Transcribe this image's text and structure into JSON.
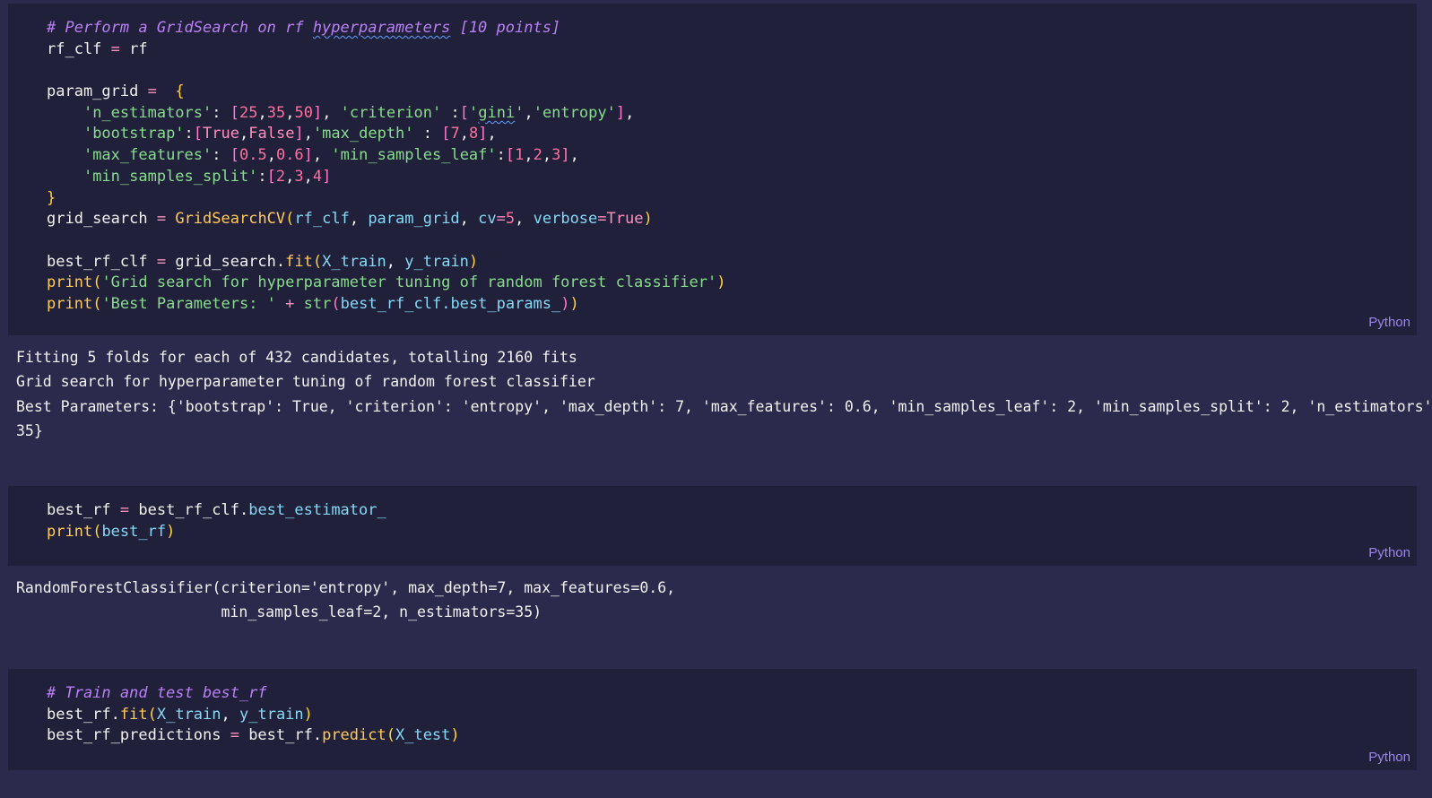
{
  "cell1": {
    "language": "Python",
    "lines": [
      [
        {
          "t": "# Perform a GridSearch on rf ",
          "c": "com"
        },
        {
          "t": "hyperparameters",
          "c": "com",
          "squig": true
        },
        {
          "t": " [10 points]",
          "c": "com"
        }
      ],
      [
        {
          "t": "rf_clf ",
          "c": ""
        },
        {
          "t": "=",
          "c": "op"
        },
        {
          "t": " rf",
          "c": ""
        }
      ],
      [],
      [
        {
          "t": "param_grid ",
          "c": ""
        },
        {
          "t": "=",
          "c": "op"
        },
        {
          "t": "  ",
          "c": ""
        },
        {
          "t": "{",
          "c": "brk"
        }
      ],
      [
        {
          "t": "    ",
          "c": ""
        },
        {
          "t": "'n_estimators'",
          "c": "str"
        },
        {
          "t": ": ",
          "c": ""
        },
        {
          "t": "[",
          "c": "brk2"
        },
        {
          "t": "25",
          "c": "num"
        },
        {
          "t": ",",
          "c": ""
        },
        {
          "t": "35",
          "c": "num"
        },
        {
          "t": ",",
          "c": ""
        },
        {
          "t": "50",
          "c": "num"
        },
        {
          "t": "]",
          "c": "brk2"
        },
        {
          "t": ", ",
          "c": ""
        },
        {
          "t": "'criterion'",
          "c": "str"
        },
        {
          "t": " :",
          "c": ""
        },
        {
          "t": "[",
          "c": "brk2"
        },
        {
          "t": "'",
          "c": "str"
        },
        {
          "t": "gini",
          "c": "str",
          "squig": true
        },
        {
          "t": "'",
          "c": "str"
        },
        {
          "t": ",",
          "c": ""
        },
        {
          "t": "'entropy'",
          "c": "str"
        },
        {
          "t": "]",
          "c": "brk2"
        },
        {
          "t": ",",
          "c": ""
        }
      ],
      [
        {
          "t": "    ",
          "c": ""
        },
        {
          "t": "'bootstrap'",
          "c": "str"
        },
        {
          "t": ":",
          "c": ""
        },
        {
          "t": "[",
          "c": "brk2"
        },
        {
          "t": "True",
          "c": "kw"
        },
        {
          "t": ",",
          "c": ""
        },
        {
          "t": "False",
          "c": "kw"
        },
        {
          "t": "]",
          "c": "brk2"
        },
        {
          "t": ",",
          "c": ""
        },
        {
          "t": "'max_depth'",
          "c": "str"
        },
        {
          "t": " : ",
          "c": ""
        },
        {
          "t": "[",
          "c": "brk2"
        },
        {
          "t": "7",
          "c": "num"
        },
        {
          "t": ",",
          "c": ""
        },
        {
          "t": "8",
          "c": "num"
        },
        {
          "t": "]",
          "c": "brk2"
        },
        {
          "t": ",",
          "c": ""
        }
      ],
      [
        {
          "t": "    ",
          "c": ""
        },
        {
          "t": "'max_features'",
          "c": "str"
        },
        {
          "t": ": ",
          "c": ""
        },
        {
          "t": "[",
          "c": "brk2"
        },
        {
          "t": "0.5",
          "c": "num"
        },
        {
          "t": ",",
          "c": ""
        },
        {
          "t": "0.6",
          "c": "num"
        },
        {
          "t": "]",
          "c": "brk2"
        },
        {
          "t": ", ",
          "c": ""
        },
        {
          "t": "'min_samples_leaf'",
          "c": "str"
        },
        {
          "t": ":",
          "c": ""
        },
        {
          "t": "[",
          "c": "brk2"
        },
        {
          "t": "1",
          "c": "num"
        },
        {
          "t": ",",
          "c": ""
        },
        {
          "t": "2",
          "c": "num"
        },
        {
          "t": ",",
          "c": ""
        },
        {
          "t": "3",
          "c": "num"
        },
        {
          "t": "]",
          "c": "brk2"
        },
        {
          "t": ",",
          "c": ""
        }
      ],
      [
        {
          "t": "    ",
          "c": ""
        },
        {
          "t": "'min_samples_split'",
          "c": "str"
        },
        {
          "t": ":",
          "c": ""
        },
        {
          "t": "[",
          "c": "brk2"
        },
        {
          "t": "2",
          "c": "num"
        },
        {
          "t": ",",
          "c": ""
        },
        {
          "t": "3",
          "c": "num"
        },
        {
          "t": ",",
          "c": ""
        },
        {
          "t": "4",
          "c": "num"
        },
        {
          "t": "]",
          "c": "brk2"
        }
      ],
      [
        {
          "t": "}",
          "c": "brk"
        }
      ],
      [
        {
          "t": "grid_search ",
          "c": ""
        },
        {
          "t": "=",
          "c": "op"
        },
        {
          "t": " ",
          "c": ""
        },
        {
          "t": "GridSearchCV",
          "c": "fn"
        },
        {
          "t": "(",
          "c": "brk"
        },
        {
          "t": "rf_clf",
          "c": "var"
        },
        {
          "t": ", ",
          "c": ""
        },
        {
          "t": "param_grid",
          "c": "var"
        },
        {
          "t": ", ",
          "c": ""
        },
        {
          "t": "cv",
          "c": "var"
        },
        {
          "t": "=",
          "c": "op"
        },
        {
          "t": "5",
          "c": "num"
        },
        {
          "t": ", ",
          "c": ""
        },
        {
          "t": "verbose",
          "c": "var"
        },
        {
          "t": "=",
          "c": "op"
        },
        {
          "t": "True",
          "c": "kw"
        },
        {
          "t": ")",
          "c": "brk"
        }
      ],
      [],
      [
        {
          "t": "best_rf_clf ",
          "c": ""
        },
        {
          "t": "=",
          "c": "op"
        },
        {
          "t": " grid_search.",
          "c": ""
        },
        {
          "t": "fit",
          "c": "fn"
        },
        {
          "t": "(",
          "c": "brk"
        },
        {
          "t": "X_train",
          "c": "var"
        },
        {
          "t": ", ",
          "c": ""
        },
        {
          "t": "y_train",
          "c": "var"
        },
        {
          "t": ")",
          "c": "brk"
        }
      ],
      [
        {
          "t": "print",
          "c": "fn"
        },
        {
          "t": "(",
          "c": "brk"
        },
        {
          "t": "'Grid search for hyperparameter tuning of random forest classifier'",
          "c": "str"
        },
        {
          "t": ")",
          "c": "brk"
        }
      ],
      [
        {
          "t": "print",
          "c": "fn"
        },
        {
          "t": "(",
          "c": "brk"
        },
        {
          "t": "'Best Parameters: '",
          "c": "str"
        },
        {
          "t": " ",
          "c": ""
        },
        {
          "t": "+",
          "c": "op"
        },
        {
          "t": " ",
          "c": ""
        },
        {
          "t": "str",
          "c": "str"
        },
        {
          "t": "(",
          "c": "brk2"
        },
        {
          "t": "best_rf_clf.best_params_",
          "c": "var"
        },
        {
          "t": ")",
          "c": "brk2"
        },
        {
          "t": ")",
          "c": "brk"
        }
      ]
    ]
  },
  "output1": {
    "lines": [
      "Fitting 5 folds for each of 432 candidates, totalling 2160 fits",
      "Grid search for hyperparameter tuning of random forest classifier",
      "Best Parameters: {'bootstrap': True, 'criterion': 'entropy', 'max_depth': 7, 'max_features': 0.6, 'min_samples_leaf': 2, 'min_samples_split': 2, 'n_estimators':",
      "35}"
    ]
  },
  "cell2": {
    "language": "Python",
    "lines": [
      [
        {
          "t": "best_rf ",
          "c": ""
        },
        {
          "t": "=",
          "c": "op"
        },
        {
          "t": " best_rf_clf.",
          "c": ""
        },
        {
          "t": "best_estimator_",
          "c": "var"
        }
      ],
      [
        {
          "t": "print",
          "c": "fn"
        },
        {
          "t": "(",
          "c": "brk"
        },
        {
          "t": "best_rf",
          "c": "var"
        },
        {
          "t": ")",
          "c": "brk"
        }
      ]
    ]
  },
  "output2": {
    "lines": [
      "RandomForestClassifier(criterion='entropy', max_depth=7, max_features=0.6,",
      "                       min_samples_leaf=2, n_estimators=35)"
    ]
  },
  "cell3": {
    "language": "Python",
    "lines": [
      [
        {
          "t": "# Train and test best_rf",
          "c": "com"
        }
      ],
      [
        {
          "t": "best_rf.",
          "c": ""
        },
        {
          "t": "fit",
          "c": "fn"
        },
        {
          "t": "(",
          "c": "brk"
        },
        {
          "t": "X_train",
          "c": "var"
        },
        {
          "t": ", ",
          "c": ""
        },
        {
          "t": "y_train",
          "c": "var"
        },
        {
          "t": ")",
          "c": "brk"
        }
      ],
      [
        {
          "t": "best_rf_predictions ",
          "c": ""
        },
        {
          "t": "=",
          "c": "op"
        },
        {
          "t": " best_rf.",
          "c": ""
        },
        {
          "t": "predict",
          "c": "fn"
        },
        {
          "t": "(",
          "c": "brk"
        },
        {
          "t": "X_test",
          "c": "var"
        },
        {
          "t": ")",
          "c": "brk"
        }
      ]
    ]
  }
}
